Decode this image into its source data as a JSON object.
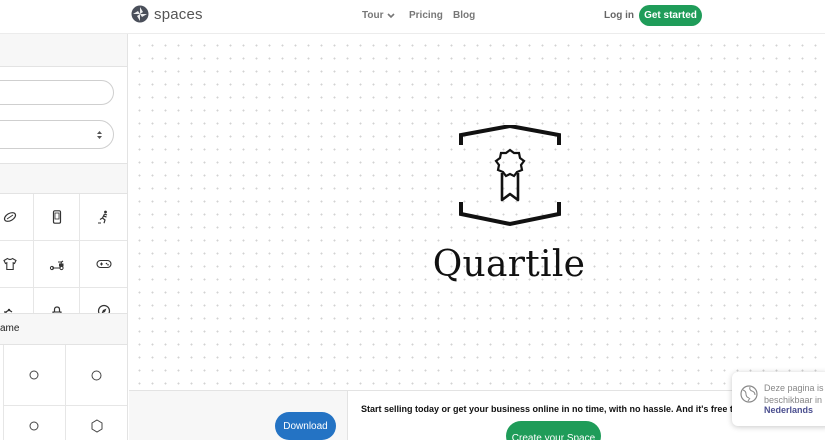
{
  "header": {
    "logo_text": "spaces",
    "nav": {
      "tour": "Tour",
      "pricing": "Pricing",
      "blog": "Blog"
    },
    "login": "Log in",
    "cta": "Get started"
  },
  "sidebar": {
    "label_fragment": "ame"
  },
  "canvas": {
    "brand_name": "Quartile"
  },
  "footer": {
    "download": "Download",
    "promo": "Start selling today or get your business online in no time, with no hassle. And it's free to u",
    "create": "Create your Space"
  },
  "language_popup": {
    "line1": "Deze pagina is",
    "line2": "beschikbaar in",
    "link": "Nederlands"
  },
  "colors": {
    "green": "#1f9c59",
    "blue": "#2473c4",
    "link_purple": "#4b4f8f"
  }
}
